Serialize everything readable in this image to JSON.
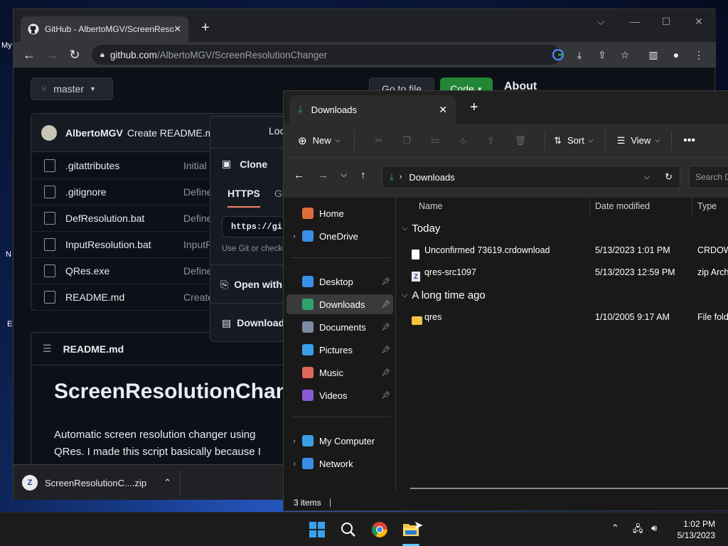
{
  "desktop": {
    "left_labels": [
      "My",
      "N",
      "E"
    ]
  },
  "chrome": {
    "tab_title": "GitHub - AlbertoMGV/ScreenResolutionChanger",
    "url_host": "github.com",
    "url_path": "/AlbertoMGV/ScreenResolutionChanger",
    "icons": [
      "github-icon",
      "close-icon",
      "plus-icon",
      "back-icon",
      "forward-icon",
      "reload-icon",
      "lock-icon",
      "google-icon",
      "install-icon",
      "share-icon",
      "star-icon",
      "sidepanel-icon",
      "profile-icon",
      "menu-icon"
    ]
  },
  "github": {
    "branch": "master",
    "go_to_file": "Go to file",
    "code_button": "Code",
    "about": "About",
    "commit_author": "AlbertoMGV",
    "commit_message": "Create README.md",
    "files": [
      {
        "name": ".gitattributes",
        "msg": "Initial"
      },
      {
        "name": ".gitignore",
        "msg": "Define"
      },
      {
        "name": "DefResolution.bat",
        "msg": "Define"
      },
      {
        "name": "InputResolution.bat",
        "msg": "InputR"
      },
      {
        "name": "QRes.exe",
        "msg": "Define"
      },
      {
        "name": "README.md",
        "msg": "Create"
      }
    ],
    "readme_header": "README.md",
    "readme_title": "ScreenResolutionChanger",
    "readme_body": "Automatic screen resolution changer using QRes. I made this script basically because I required to change it almost daily and it was a little bit annoying going",
    "clone": {
      "local_label": "Local",
      "title": "Clone",
      "tab_https": "HTTPS",
      "tab_gh": "GitHub CLI",
      "url": "https://github.com/AlbertoMGV/ScreenResolutionChanger.git",
      "hint": "Use Git or checkout with SVN using the web URL.",
      "open_with": "Open with GitHub Desktop",
      "download": "Download ZIP"
    }
  },
  "download_bar": {
    "file": "ScreenResolutionC....zip"
  },
  "explorer": {
    "tab_title": "Downloads",
    "commands": {
      "new": "New",
      "sort": "Sort",
      "view": "View"
    },
    "address": "Downloads",
    "search_placeholder": "Search Downloads",
    "nav": [
      {
        "label": "Home",
        "icon": "home-icon",
        "color": "#e06c3c",
        "expandable": false,
        "pinned": false,
        "selected": false
      },
      {
        "label": "OneDrive",
        "icon": "cloud-icon",
        "color": "#3a8ee6",
        "expandable": true,
        "pinned": false,
        "selected": false
      },
      {
        "label": "Desktop",
        "icon": "desktop-icon",
        "color": "#3a8ee6",
        "expandable": false,
        "pinned": true,
        "selected": false
      },
      {
        "label": "Downloads",
        "icon": "download-icon",
        "color": "#2ea36b",
        "expandable": false,
        "pinned": true,
        "selected": true
      },
      {
        "label": "Documents",
        "icon": "document-icon",
        "color": "#7d8ba3",
        "expandable": false,
        "pinned": true,
        "selected": false
      },
      {
        "label": "Pictures",
        "icon": "pictures-icon",
        "color": "#3aa0e6",
        "expandable": false,
        "pinned": true,
        "selected": false
      },
      {
        "label": "Music",
        "icon": "music-icon",
        "color": "#e0685a",
        "expandable": false,
        "pinned": true,
        "selected": false
      },
      {
        "label": "Videos",
        "icon": "videos-icon",
        "color": "#8a5ad6",
        "expandable": false,
        "pinned": true,
        "selected": false
      },
      {
        "label": "My Computer",
        "icon": "computer-icon",
        "color": "#3aa0e6",
        "expandable": true,
        "pinned": false,
        "selected": false
      },
      {
        "label": "Network",
        "icon": "network-icon",
        "color": "#3a8ee6",
        "expandable": true,
        "pinned": false,
        "selected": false
      }
    ],
    "columns": {
      "name": "Name",
      "date": "Date modified",
      "type": "Type"
    },
    "groups": [
      {
        "title": "Today",
        "items": [
          {
            "name": "Unconfirmed 73619.crdownload",
            "date": "5/13/2023 1:01 PM",
            "type": "CRDOWNLOAD File",
            "icon": "file-icon"
          },
          {
            "name": "qres-src1097",
            "date": "5/13/2023 12:59 PM",
            "type": "zip Archive",
            "icon": "zip-icon"
          }
        ]
      },
      {
        "title": "A long time ago",
        "items": [
          {
            "name": "qres",
            "date": "1/10/2005 9:17 AM",
            "type": "File folder",
            "icon": "folder-icon"
          }
        ]
      }
    ],
    "status": "3 items"
  },
  "taskbar": {
    "time": "1:02 PM",
    "date": "5/13/2023",
    "apps": [
      "windows-start-icon",
      "search-icon",
      "chrome-icon",
      "file-explorer-icon"
    ]
  }
}
